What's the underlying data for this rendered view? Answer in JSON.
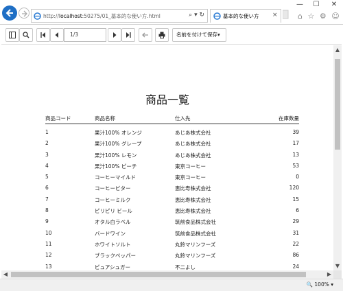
{
  "browser": {
    "url_prefix": "http://",
    "url_host": "localhost",
    "url_rest": ":50275/01_基本的な使い方.html",
    "address_icons": "⌕ ▾ ↻",
    "tab_title": "基本的な使い方",
    "tab_close": "×",
    "window_controls": [
      "—",
      "☐",
      "✕"
    ],
    "tools_icons": "⌂ ☆ ⚙ ☺"
  },
  "toolbar": {
    "page_value": "1/3",
    "save_label": "名前を付けて保存▾"
  },
  "report": {
    "title": "商品一覧",
    "headers": {
      "code": "商品コード",
      "name": "商品名称",
      "supplier": "仕入先",
      "stock": "在庫数量"
    },
    "rows": [
      {
        "code": "1",
        "name": "果汁100% オレンジ",
        "supplier": "あじあ株式会社",
        "stock": "39"
      },
      {
        "code": "2",
        "name": "果汁100% グレープ",
        "supplier": "あじあ株式会社",
        "stock": "17"
      },
      {
        "code": "3",
        "name": "果汁100% レモン",
        "supplier": "あじあ株式会社",
        "stock": "13"
      },
      {
        "code": "4",
        "name": "果汁100% ピーチ",
        "supplier": "東京コーヒー",
        "stock": "53"
      },
      {
        "code": "5",
        "name": "コーヒーマイルド",
        "supplier": "東京コーヒー",
        "stock": "0"
      },
      {
        "code": "6",
        "name": "コーヒービター",
        "supplier": "恵比寿株式会社",
        "stock": "120"
      },
      {
        "code": "7",
        "name": "コーヒーミルク",
        "supplier": "恵比寿株式会社",
        "stock": "15"
      },
      {
        "code": "8",
        "name": "ピリピリ ビール",
        "supplier": "恵比寿株式会社",
        "stock": "6"
      },
      {
        "code": "9",
        "name": "オタル白ラベル",
        "supplier": "筑前食品株式会社",
        "stock": "29"
      },
      {
        "code": "10",
        "name": "バードワイン",
        "supplier": "筑前食品株式会社",
        "stock": "31"
      },
      {
        "code": "11",
        "name": "ホワイトソルト",
        "supplier": "丸鈴マリンフーズ",
        "stock": "22"
      },
      {
        "code": "12",
        "name": "ブラックペッパー",
        "supplier": "丸鈴マリンフーズ",
        "stock": "86"
      },
      {
        "code": "13",
        "name": "ピュアシュガー",
        "supplier": "不二よし",
        "stock": "24"
      }
    ]
  },
  "status": {
    "zoom": "🔍 100% ▾"
  }
}
